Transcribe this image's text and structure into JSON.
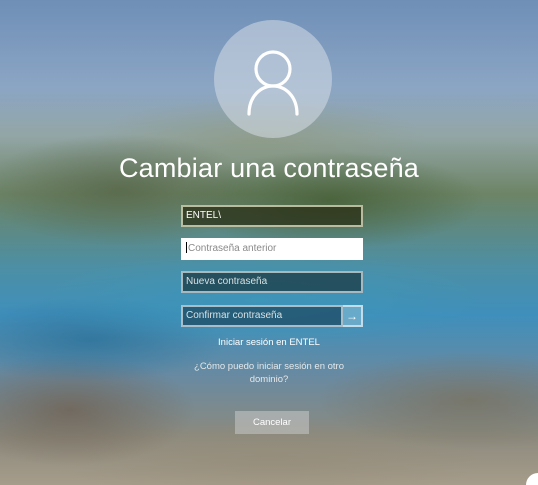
{
  "icons": {
    "avatar": "user-silhouette-icon",
    "submit": "arrow-right-icon"
  },
  "colors": {
    "text": "#ffffff",
    "placeholder": "#8a8a8a"
  },
  "page": {
    "title": "Cambiar una contraseña"
  },
  "form": {
    "username_value": "ENTEL\\",
    "old_password_placeholder": "Contraseña anterior",
    "new_password_placeholder": "Nueva contraseña",
    "confirm_password_placeholder": "Confirmar contraseña",
    "submit_glyph": "→"
  },
  "links": {
    "sign_in": "Iniciar sesión en ENTEL",
    "other_domain": "¿Cómo puedo iniciar sesión en otro dominio?"
  },
  "buttons": {
    "cancel": "Cancelar"
  }
}
